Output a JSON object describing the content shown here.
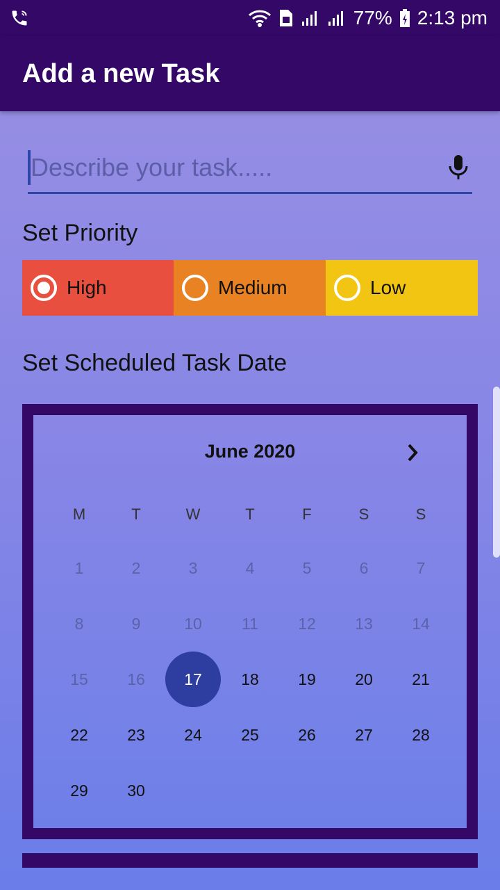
{
  "status_bar": {
    "battery": "77%",
    "time": "2:13 pm",
    "icons": [
      "phone-call-icon",
      "wifi-icon",
      "sim-icon",
      "signal-icon",
      "signal-icon",
      "battery-icon"
    ]
  },
  "app_bar": {
    "title": "Add a new Task"
  },
  "task_input": {
    "value": "",
    "placeholder": "Describe your task.....",
    "icon": "mic-icon"
  },
  "priority": {
    "title": "Set Priority",
    "options": [
      {
        "label": "High",
        "selected": true,
        "color": "#e94f3e"
      },
      {
        "label": "Medium",
        "selected": false,
        "color": "#e88222"
      },
      {
        "label": "Low",
        "selected": false,
        "color": "#f1c511"
      }
    ]
  },
  "schedule": {
    "title": "Set Scheduled Task Date"
  },
  "calendar": {
    "month": "June 2020",
    "weekdays": [
      "M",
      "T",
      "W",
      "T",
      "F",
      "S",
      "S"
    ],
    "days": [
      {
        "d": "1",
        "disabled": true
      },
      {
        "d": "2",
        "disabled": true
      },
      {
        "d": "3",
        "disabled": true
      },
      {
        "d": "4",
        "disabled": true
      },
      {
        "d": "5",
        "disabled": true
      },
      {
        "d": "6",
        "disabled": true
      },
      {
        "d": "7",
        "disabled": true
      },
      {
        "d": "8",
        "disabled": true
      },
      {
        "d": "9",
        "disabled": true
      },
      {
        "d": "10",
        "disabled": true
      },
      {
        "d": "11",
        "disabled": true
      },
      {
        "d": "12",
        "disabled": true
      },
      {
        "d": "13",
        "disabled": true
      },
      {
        "d": "14",
        "disabled": true
      },
      {
        "d": "15",
        "disabled": true
      },
      {
        "d": "16",
        "disabled": true
      },
      {
        "d": "17",
        "selected": true
      },
      {
        "d": "18"
      },
      {
        "d": "19"
      },
      {
        "d": "20"
      },
      {
        "d": "21"
      },
      {
        "d": "22"
      },
      {
        "d": "23"
      },
      {
        "d": "24"
      },
      {
        "d": "25"
      },
      {
        "d": "26"
      },
      {
        "d": "27"
      },
      {
        "d": "28"
      },
      {
        "d": "29"
      },
      {
        "d": "30"
      }
    ]
  },
  "colors": {
    "app_bar": "#330867",
    "selected_day": "#2e3da0",
    "accent": "#2e46a8"
  }
}
